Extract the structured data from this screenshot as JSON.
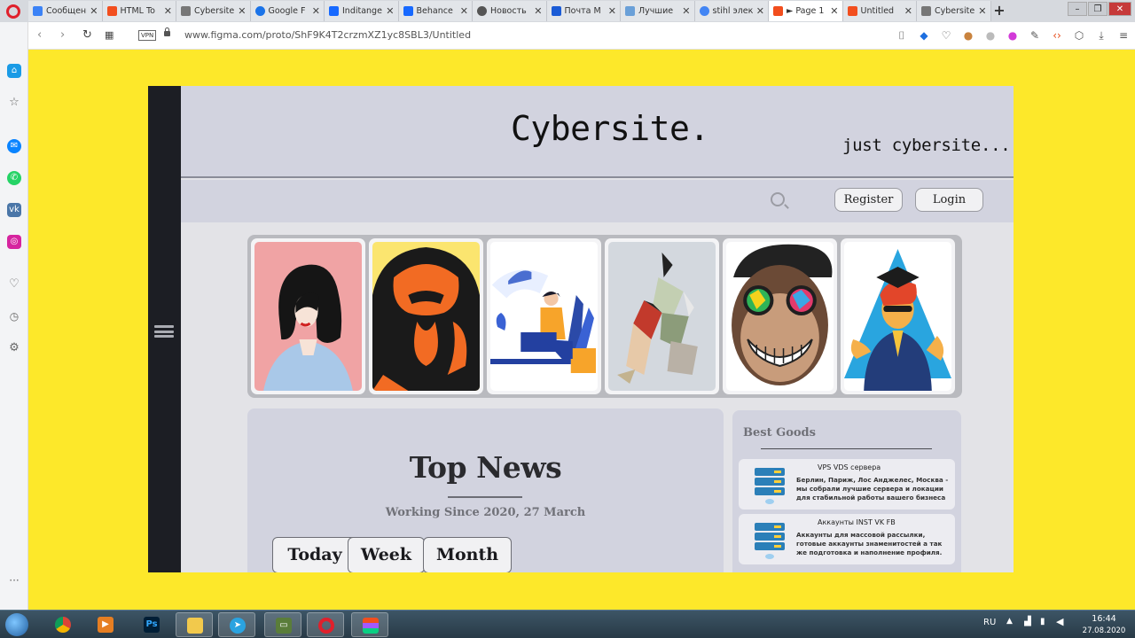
{
  "browser": {
    "tabs": [
      {
        "label": "Сообщения",
        "color": "#3b82f6",
        "active": false
      },
      {
        "label": "HTML To",
        "color": "#f24e1e",
        "active": false
      },
      {
        "label": "Cybersite",
        "color": "#777777",
        "active": false
      },
      {
        "label": "Google F",
        "color": "#1a73e8",
        "active": false
      },
      {
        "label": "Inditange",
        "color": "#1769ff",
        "active": false
      },
      {
        "label": "Behance",
        "color": "#1769ff",
        "active": false
      },
      {
        "label": "Новость",
        "color": "#555555",
        "active": false
      },
      {
        "label": "Почта M",
        "color": "#1a5bd6",
        "active": false
      },
      {
        "label": "Лучшие",
        "color": "#6aa0d8",
        "active": false
      },
      {
        "label": "stihl элек",
        "color": "#4285f4",
        "active": false
      },
      {
        "label": "► Page 1",
        "color": "#f24e1e",
        "active": true
      },
      {
        "label": "Untitled",
        "color": "#f24e1e",
        "active": false
      },
      {
        "label": "Cybersite",
        "color": "#777777",
        "active": false
      }
    ],
    "new_tab": "+",
    "vpn_label": "VPN",
    "url": "www.figma.com/proto/ShF9K4T2crzmXZ1yc8SBL3/Untitled"
  },
  "site": {
    "title": "Cybersite.",
    "subtitle": "just cybersite...",
    "register_label": "Register",
    "login_label": "Login",
    "gallery": [
      "woman-portrait",
      "gorilla",
      "desk-worker",
      "geometric-couple",
      "monkey-sunglasses",
      "graduate"
    ],
    "news": {
      "title": "Top News",
      "subtitle": "Working Since 2020, 27 March",
      "tabs": [
        "Today",
        "Week",
        "Month"
      ]
    },
    "goods": {
      "title": "Best Goods",
      "items": [
        {
          "title": "VPS VDS сервера",
          "desc": "Берлин, Париж, Лос Анджелес, Москва - мы собрали лучшие сервера и локации для стабильной работы вашего бизнеса"
        },
        {
          "title": "Аккаунты INST VK FB",
          "desc": "Аккаунты для массовой рассылки, готовые аккаунты знаменитостей а так же подготовка и наполнение профиля."
        }
      ]
    }
  },
  "taskbar": {
    "lang": "RU",
    "time": "16:44",
    "date": "27.08.2020"
  },
  "colors": {
    "stage": "#fde82a",
    "header": "#d2d3df",
    "dark_strip": "#1c1e24"
  }
}
